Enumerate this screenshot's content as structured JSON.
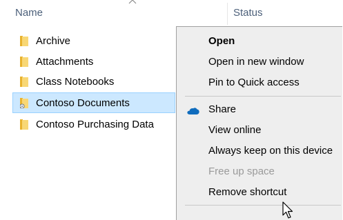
{
  "header": {
    "name_label": "Name",
    "status_label": "Status"
  },
  "files": [
    {
      "label": "Archive"
    },
    {
      "label": "Attachments"
    },
    {
      "label": "Class Notebooks"
    },
    {
      "label": "Contoso Documents",
      "selected": true
    },
    {
      "label": "Contoso Purchasing Data"
    }
  ],
  "context_menu": {
    "items": [
      {
        "label": "Open"
      },
      {
        "label": "Open in new window"
      },
      {
        "label": "Pin to Quick access"
      },
      {
        "label": "Share",
        "icon": "onedrive-cloud-icon"
      },
      {
        "label": "View online"
      },
      {
        "label": "Always keep on this device"
      },
      {
        "label": "Free up space",
        "disabled": true
      },
      {
        "label": "Remove shortcut"
      }
    ]
  },
  "colors": {
    "header_text": "#4c607a",
    "selection_bg": "#cce8ff",
    "selection_border": "#99d1ff",
    "menu_bg": "#eeeeee",
    "folder_yellow": "#f8d775",
    "onedrive_blue": "#0f6cbd"
  }
}
